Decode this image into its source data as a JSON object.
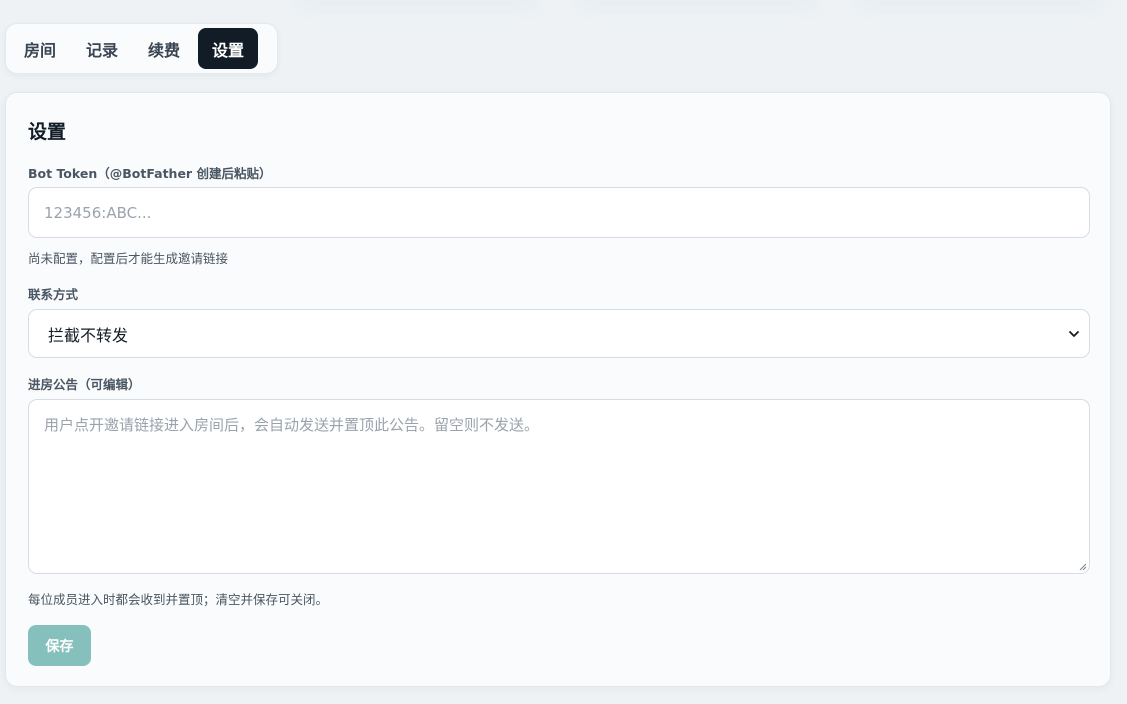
{
  "tabs": [
    {
      "label": "房间"
    },
    {
      "label": "记录"
    },
    {
      "label": "续费"
    },
    {
      "label": "设置"
    }
  ],
  "active_tab": "设置",
  "settings": {
    "title": "设置",
    "bot_token": {
      "label": "Bot Token（@BotFather 创建后粘贴）",
      "value": "",
      "placeholder": "123456:ABC...",
      "hint": "尚未配置，配置后才能生成邀请链接"
    },
    "contact": {
      "label": "联系方式",
      "selected": "拦截不转发"
    },
    "announcement": {
      "label": "进房公告（可编辑）",
      "value": "",
      "placeholder": "用户点开邀请链接进入房间后，会自动发送并置顶此公告。留空则不发送。",
      "hint": "每位成员进入时都会收到并置顶；清空并保存可关闭。"
    },
    "save_label": "保存"
  },
  "colors": {
    "active_tab_bg": "#111c26",
    "save_button_bg": "#85c0bc",
    "page_bg": "#eef2f5"
  }
}
